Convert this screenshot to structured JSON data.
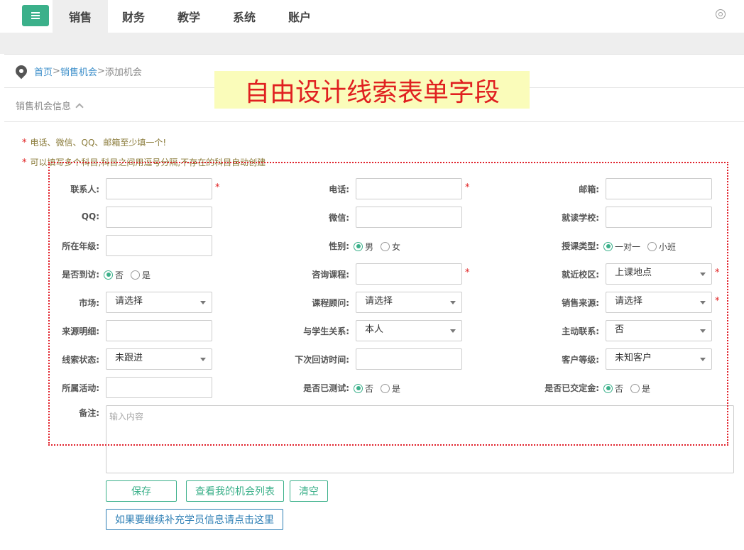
{
  "nav": {
    "tabs": [
      "销售",
      "财务",
      "教学",
      "系统",
      "账户"
    ]
  },
  "breadcrumb": {
    "home": "首页",
    "sep1": ">",
    "sales": "销售机会",
    "sep2": ">",
    "current": "添加机会"
  },
  "section_title": "销售机会信息",
  "banner": "自由设计线索表单字段",
  "notes": {
    "n1": "电话、微信、QQ、邮箱至少填一个!",
    "n2": "可以填写多个科目,科目之间用逗号分隔,不存在的科目自动创建",
    "star": "*"
  },
  "form": {
    "contact": "联系人:",
    "phone": "电话:",
    "email": "邮箱:",
    "qq": "QQ:",
    "wechat": "微信:",
    "school": "就读学校:",
    "grade": "所在年级:",
    "gender": "性别:",
    "gender_male": "男",
    "gender_female": "女",
    "class_type": "授课类型:",
    "class_one": "一对一",
    "class_small": "小班",
    "visited": "是否到访:",
    "no": "否",
    "yes": "是",
    "course": "咨询课程:",
    "campus": "就近校区:",
    "campus_value": "上课地点",
    "market": "市场:",
    "market_value": "请选择",
    "advisor": "课程顾问:",
    "advisor_value": "请选择",
    "source": "销售来源:",
    "source_value": "请选择",
    "source_detail": "来源明细:",
    "relation": "与学生关系:",
    "relation_value": "本人",
    "active_contact": "主动联系:",
    "active_contact_value": "否",
    "lead_status": "线索状态:",
    "lead_status_value": "未跟进",
    "next_visit": "下次回访时间:",
    "customer_level": "客户等级:",
    "customer_level_value": "未知客户",
    "activity": "所属活动:",
    "tested": "是否已测试:",
    "deposit": "是否已交定金:",
    "remark": "备注:",
    "remark_placeholder": "输入内容",
    "required_mark": "*"
  },
  "buttons": {
    "save": "保存",
    "view_list": "查看我的机会列表",
    "clear": "清空",
    "continue": "如果要继续补充学员信息请点击这里"
  },
  "colors": {
    "accent": "#3bb08a",
    "link": "#3a8dc9",
    "required": "#e02020"
  }
}
